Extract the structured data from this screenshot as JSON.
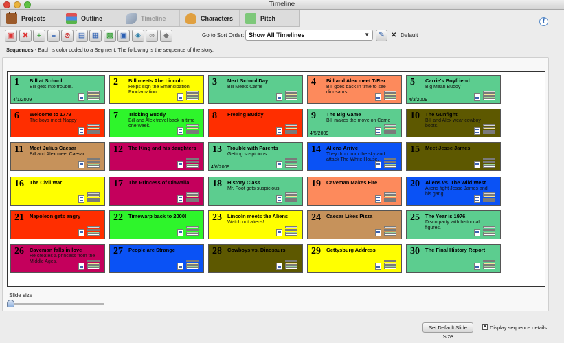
{
  "window": {
    "title": "Timeline"
  },
  "tabs": [
    {
      "label": "Projects",
      "icon": "briefcase-icon",
      "active": false
    },
    {
      "label": "Outline",
      "icon": "outline-icon",
      "active": false
    },
    {
      "label": "Timeline",
      "icon": "timeline-icon",
      "active": true
    },
    {
      "label": "Characters",
      "icon": "characters-icon",
      "active": false
    },
    {
      "label": "Pitch",
      "icon": "pitch-icon",
      "active": false
    }
  ],
  "toolbar": {
    "buttons": [
      {
        "name": "add-card-icon",
        "glyph": "▣",
        "color": "#d33"
      },
      {
        "name": "delete-card-icon",
        "glyph": "✖",
        "color": "#d33"
      },
      {
        "name": "add-sequence-icon",
        "glyph": "+",
        "color": "#2a9a2a"
      },
      {
        "name": "insert-card-icon",
        "glyph": "≡",
        "color": "#2b5fb3"
      },
      {
        "name": "remove-card-icon",
        "glyph": "⊗",
        "color": "#c22"
      },
      {
        "name": "layout-icon",
        "glyph": "▤",
        "color": "#2b5fb3"
      },
      {
        "name": "grid-view-icon",
        "glyph": "▦",
        "color": "#2b5fb3"
      },
      {
        "name": "color-grid-icon",
        "glyph": "▩",
        "color": "#2a9a2a"
      },
      {
        "name": "save-icon",
        "glyph": "▣",
        "color": "#2b5fb3"
      },
      {
        "name": "layers-icon",
        "glyph": "◈",
        "color": "#2b7fa8"
      },
      {
        "name": "link-icon",
        "glyph": "∞",
        "color": "#777"
      },
      {
        "name": "cube-icon",
        "glyph": "◆",
        "color": "#777"
      }
    ],
    "sort_label": "Go to Sort Order:",
    "sort_value": "Show All Timelines",
    "default_label": "Default",
    "default_x": "✕"
  },
  "sequences": {
    "heading": "Sequences",
    "description": " - Each is color coded to a Segment. The following is the sequence of the story."
  },
  "colors": {
    "green": "#5ccd8f",
    "yellow": "#ffff00",
    "salmon": "#fd8a5c",
    "red": "#ff2e00",
    "lime": "#2ef52b",
    "olive": "#5d5800",
    "tan": "#c6925b",
    "magenta": "#c4005c",
    "blue": "#0a52f5"
  },
  "cards": [
    {
      "num": "1",
      "title": "Bill at School",
      "desc": "Bill gets into trouble.",
      "date": "4/1/2009",
      "color": "green"
    },
    {
      "num": "2",
      "title": "Bill meets Abe Lincoln",
      "desc": "Helps sign the Emancipation Proclamation.",
      "date": "",
      "color": "yellow"
    },
    {
      "num": "3",
      "title": "Next School Day",
      "desc": "Bill Meets Carrie",
      "date": "",
      "color": "green"
    },
    {
      "num": "4",
      "title": "Bill and Alex meet T-Rex",
      "desc": "Bill goes back in time to see dinosaurs.",
      "date": "",
      "color": "salmon"
    },
    {
      "num": "5",
      "title": "Carrie's Boyfriend",
      "desc": "Big Mean Buddy",
      "date": "4/3/2009",
      "color": "green"
    },
    {
      "num": "6",
      "title": "Welcome to 1779",
      "desc": "The boys meet Nappy",
      "date": "",
      "color": "red"
    },
    {
      "num": "7",
      "title": "Tricking Buddy",
      "desc": "Bill and Alex travel back in time one week.",
      "date": "",
      "color": "lime"
    },
    {
      "num": "8",
      "title": "Freeing Buddy",
      "desc": "",
      "date": "",
      "color": "red"
    },
    {
      "num": "9",
      "title": "The Big Game",
      "desc": "Bill makes the move on Carrie",
      "date": "4/5/2009",
      "color": "green"
    },
    {
      "num": "10",
      "title": "The Gunfight",
      "desc": "Bill and Alex wear cowboy boots.",
      "date": "",
      "color": "olive"
    },
    {
      "num": "11",
      "title": "Meet Julius Caesar",
      "desc": "Bill and Alex meet Caesar.",
      "date": "",
      "color": "tan"
    },
    {
      "num": "12",
      "title": "The King and his daughters",
      "desc": "",
      "date": "",
      "color": "magenta"
    },
    {
      "num": "13",
      "title": "Trouble with Parents",
      "desc": "Getting suspicious",
      "date": "4/6/2009",
      "color": "green"
    },
    {
      "num": "14",
      "title": "Aliens Arrive",
      "desc": "They drop from the sky and attack The White House.",
      "date": "",
      "color": "blue"
    },
    {
      "num": "15",
      "title": "Meet Jesse James",
      "desc": "",
      "date": "",
      "color": "olive"
    },
    {
      "num": "16",
      "title": "The Civil War",
      "desc": "",
      "date": "",
      "color": "yellow"
    },
    {
      "num": "17",
      "title": "The Princess of Olawaila",
      "desc": "",
      "date": "",
      "color": "magenta"
    },
    {
      "num": "18",
      "title": "History Class",
      "desc": "Mr. Foot gets suspicious.",
      "date": "",
      "color": "green"
    },
    {
      "num": "19",
      "title": "Caveman Makes Fire",
      "desc": "",
      "date": "",
      "color": "salmon"
    },
    {
      "num": "20",
      "title": "Aliens vs. The Wild West",
      "desc": "Aliens fight Jesse James and his gang.",
      "date": "",
      "color": "blue"
    },
    {
      "num": "21",
      "title": "Napoleon gets angry",
      "desc": "",
      "date": "",
      "color": "red"
    },
    {
      "num": "22",
      "title": "Timewarp back to 2000!",
      "desc": "",
      "date": "",
      "color": "lime"
    },
    {
      "num": "23",
      "title": "Lincoln meets the Aliens",
      "desc": "Watch out aliens!",
      "date": "",
      "color": "yellow"
    },
    {
      "num": "24",
      "title": "Caesar Likes Pizza",
      "desc": "",
      "date": "",
      "color": "tan"
    },
    {
      "num": "25",
      "title": "The Year is 1976!",
      "desc": "Disco party with historical figures.",
      "date": "",
      "color": "green"
    },
    {
      "num": "26",
      "title": "Caveman falls in love",
      "desc": "He creates a princess from the Middle Ages.",
      "date": "",
      "color": "magenta"
    },
    {
      "num": "27",
      "title": "People are Strange",
      "desc": "",
      "date": "",
      "color": "blue"
    },
    {
      "num": "28",
      "title": "Cowboys vs. Dinosaurs",
      "desc": "",
      "date": "",
      "color": "olive"
    },
    {
      "num": "29",
      "title": "Gettysburg Address",
      "desc": "",
      "date": "",
      "color": "yellow"
    },
    {
      "num": "30",
      "title": "The Final History Report",
      "desc": "",
      "date": "",
      "color": "green"
    }
  ],
  "bottom": {
    "slide_size_label": "Slide size",
    "set_default_label": "Set Default Slide Size",
    "display_details_label": "Display sequence details",
    "display_details_checked": "✕"
  }
}
